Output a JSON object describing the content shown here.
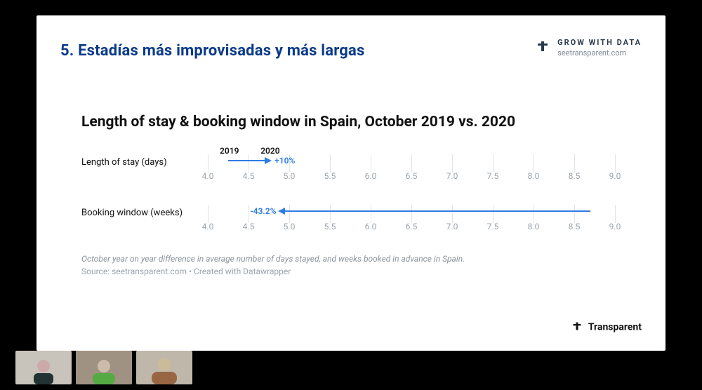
{
  "header": {
    "title": "5. Estadías más improvisadas y más largas",
    "brand_line1": "GROW WITH DATA",
    "brand_line2": "seetransparent.com"
  },
  "footer_brand": "Transparent",
  "chart": {
    "title": "Length of stay & booking window in Spain, October 2019 vs. 2020",
    "row1_label": "Length of stay (days)",
    "row2_label": "Booking window (weeks)",
    "lbl_2019": "2019",
    "lbl_2020": "2020",
    "annot1": "+10%",
    "annot2": "-43.2%",
    "footnote": "October year on year difference in average number of days stayed, and weeks booked in advance in Spain.",
    "source": "Source: seetransparent.com • Created with Datawrapper"
  },
  "chart_data": {
    "type": "bar",
    "title": "Length of stay & booking window in Spain, October 2019 vs. 2020",
    "xlabel": "",
    "ylabel": "",
    "xlim": [
      4.0,
      9.0
    ],
    "ticks": [
      4.0,
      4.5,
      5.0,
      5.5,
      6.0,
      6.5,
      7.0,
      7.5,
      8.0,
      8.5,
      9.0
    ],
    "series": [
      {
        "name": "Length of stay (days)",
        "start_year": 2019,
        "end_year": 2020,
        "start_value": 4.25,
        "end_value": 4.7,
        "pct_change": 10.0,
        "direction": "up"
      },
      {
        "name": "Booking window (weeks)",
        "start_year": 2019,
        "end_year": 2020,
        "start_value": 8.7,
        "end_value": 4.95,
        "pct_change": -43.2,
        "direction": "down"
      }
    ],
    "footnote": "October year on year difference in average number of days stayed, and weeks booked in advance in Spain.",
    "source": "seetransparent.com • Created with Datawrapper"
  }
}
